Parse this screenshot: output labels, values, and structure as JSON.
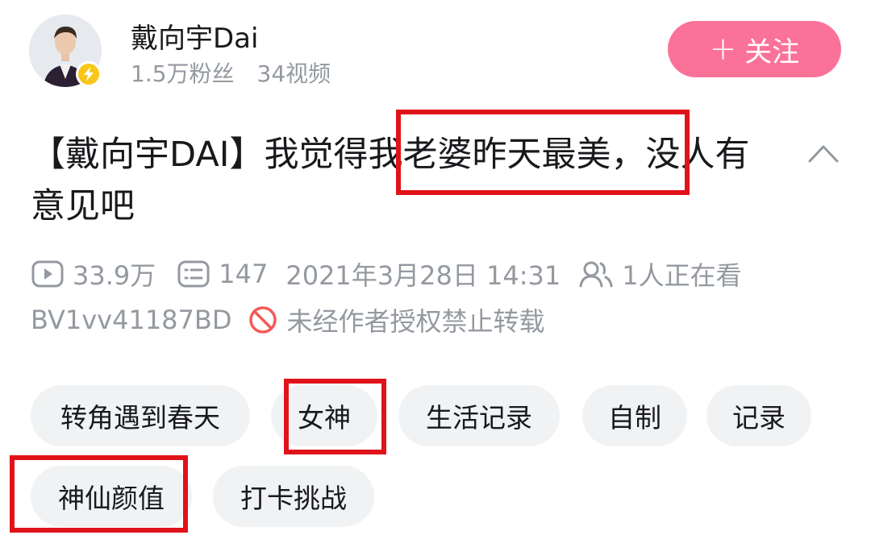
{
  "uploader": {
    "name": "戴向宇Dai",
    "followers": "1.5万粉丝",
    "videos": "34视频",
    "follow_label": "关注"
  },
  "video": {
    "title": "【戴向宇DAI】我觉得我老婆昨天最美，没人有意见吧",
    "views": "33.9万",
    "comments": "147",
    "published": "2021年3月28日 14:31",
    "watching": "1人正在看",
    "bvid": "BV1vv41187BD",
    "repost_notice": "未经作者授权禁止转载"
  },
  "tags": [
    "转角遇到春天",
    "女神",
    "生活记录",
    "自制",
    "记录",
    "神仙颜值",
    "打卡挑战"
  ],
  "colors": {
    "accent": "#fb7299",
    "verified_badge": "#f8c618",
    "annotation_box": "#e0131a",
    "meta_text": "#9499a0",
    "tag_background": "#f1f2f3"
  },
  "icons": [
    "verified-badge-icon",
    "plus-icon",
    "chevron-up-icon",
    "play-icon",
    "comment-icon",
    "viewers-icon",
    "no-repost-icon"
  ]
}
